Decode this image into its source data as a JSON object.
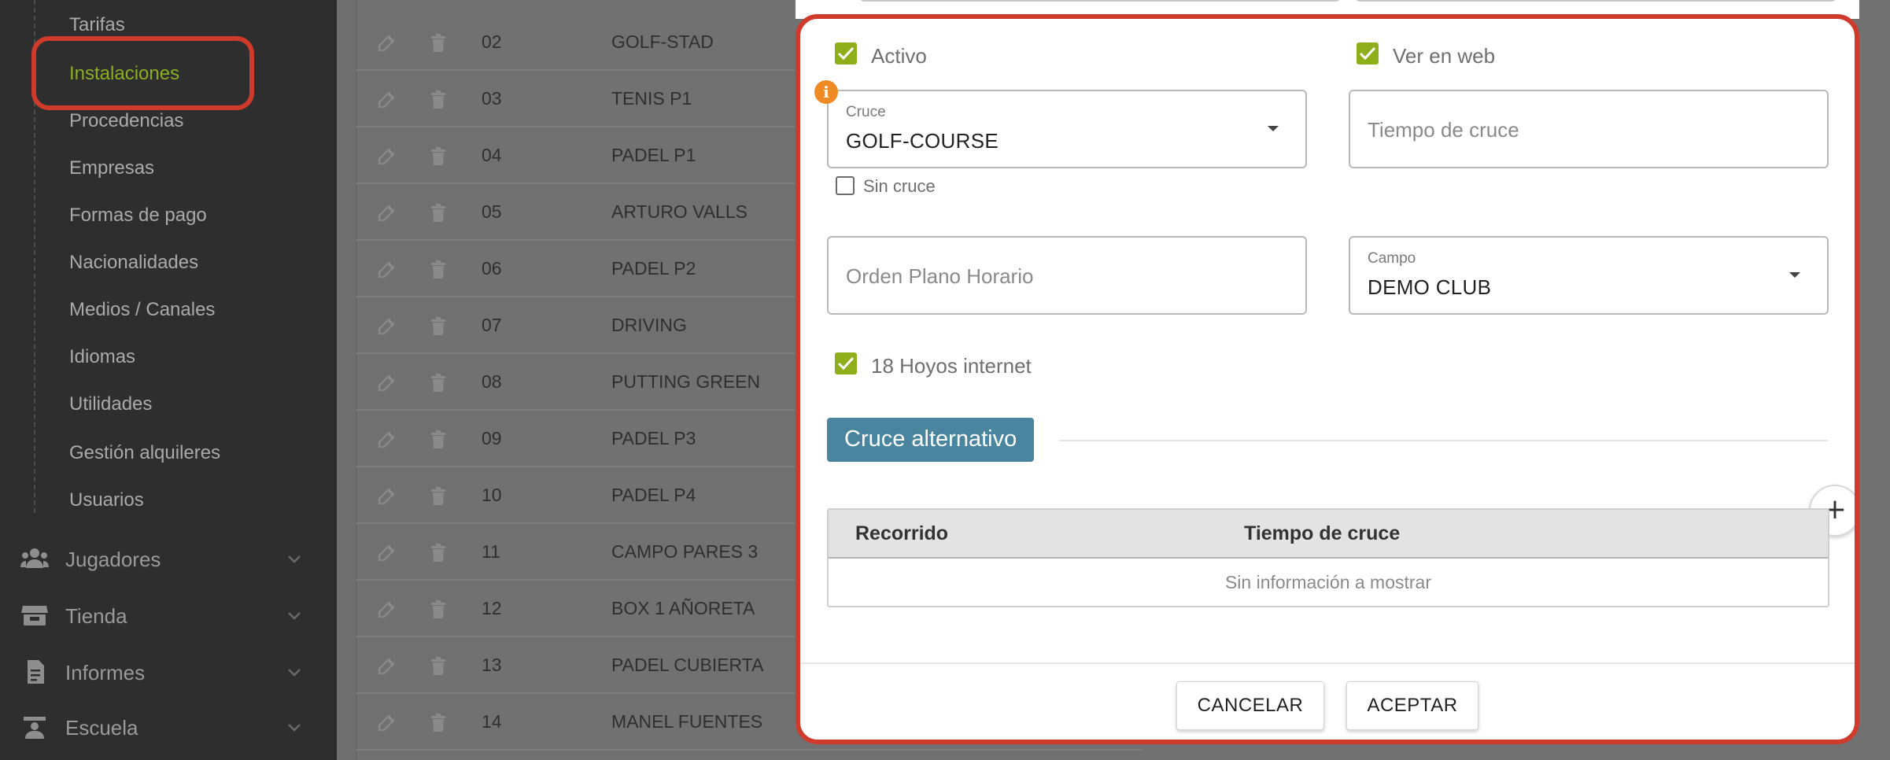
{
  "sidebar": {
    "sub_items": [
      {
        "label": "Tarifas"
      },
      {
        "label": "Instalaciones",
        "active": true
      },
      {
        "label": "Procedencias"
      },
      {
        "label": "Empresas"
      },
      {
        "label": "Formas de pago"
      },
      {
        "label": "Nacionalidades"
      },
      {
        "label": "Medios / Canales"
      },
      {
        "label": "Idiomas"
      },
      {
        "label": "Utilidades"
      },
      {
        "label": "Gestión alquileres"
      },
      {
        "label": "Usuarios"
      }
    ],
    "sections": [
      {
        "label": "Jugadores",
        "icon": "users-icon"
      },
      {
        "label": "Tienda",
        "icon": "store-icon"
      },
      {
        "label": "Informes",
        "icon": "report-icon"
      },
      {
        "label": "Escuela",
        "icon": "school-icon"
      }
    ]
  },
  "table": {
    "rows": [
      {
        "code": "02",
        "name": "GOLF-STAD"
      },
      {
        "code": "03",
        "name": "TENIS P1"
      },
      {
        "code": "04",
        "name": "PADEL P1"
      },
      {
        "code": "05",
        "name": "ARTURO VALLS"
      },
      {
        "code": "06",
        "name": "PADEL P2"
      },
      {
        "code": "07",
        "name": "DRIVING"
      },
      {
        "code": "08",
        "name": "PUTTING GREEN"
      },
      {
        "code": "09",
        "name": "PADEL P3"
      },
      {
        "code": "10",
        "name": "PADEL P4"
      },
      {
        "code": "11",
        "name": "CAMPO PARES 3"
      },
      {
        "code": "12",
        "name": "BOX 1 AÑORETA"
      },
      {
        "code": "13",
        "name": "PADEL CUBIERTA"
      },
      {
        "code": "14",
        "name": "MANEL FUENTES"
      }
    ]
  },
  "modal": {
    "activo_label": "Activo",
    "activo_checked": true,
    "ver_web_label": "Ver en web",
    "ver_web_checked": true,
    "cruce": {
      "label": "Cruce",
      "value": "GOLF-COURSE"
    },
    "sin_cruce_label": "Sin cruce",
    "sin_cruce_checked": false,
    "tiempo_cruce_placeholder": "Tiempo de cruce",
    "orden_plano_placeholder": "Orden Plano Horario",
    "campo": {
      "label": "Campo",
      "value": "DEMO CLUB"
    },
    "hoyos_label": "18 Hoyos internet",
    "hoyos_checked": true,
    "alt_section_title": "Cruce alternativo",
    "grid": {
      "columns": [
        "Recorrido",
        "Tiempo de cruce"
      ],
      "empty_text": "Sin información a mostrar"
    },
    "cancel_label": "CANCELAR",
    "accept_label": "ACEPTAR"
  },
  "colors": {
    "accent_green": "#8fae1b",
    "highlight_red": "#d03a2b",
    "section_blue": "#4a85a0",
    "info_orange": "#f08a24"
  }
}
